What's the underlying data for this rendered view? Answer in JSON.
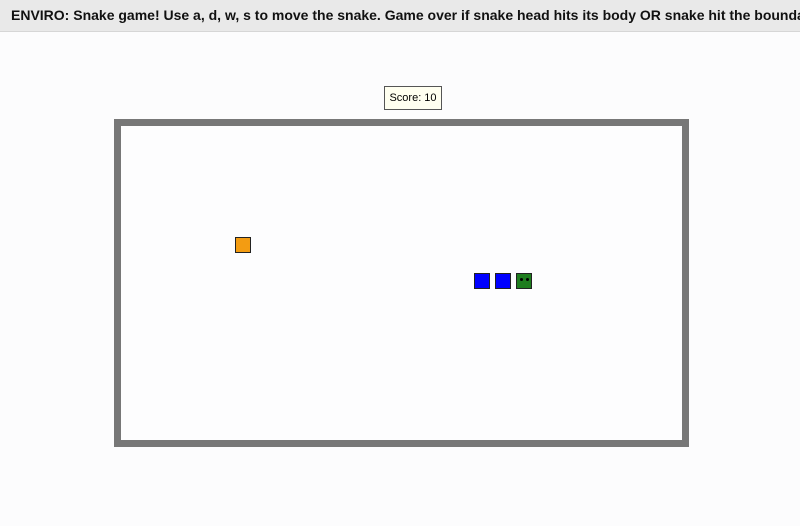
{
  "header": {
    "instructions": "ENVIRO: Snake game! Use a, d, w, s to move the snake. Game over if snake head hits its body OR snake hit the boundary"
  },
  "score": {
    "label": "Score: 10",
    "value": 10
  },
  "colors": {
    "topbar": "#e9e9e9",
    "boundary": "#777777",
    "board": "#fdfdfe",
    "food": "#f39c12",
    "snake_body": "#0000ff",
    "snake_head": "#1e7d1e"
  },
  "icons": {
    "food": "food-square-icon",
    "snake_head": "snake-head-icon",
    "snake_body": "snake-body-segment-icon"
  }
}
